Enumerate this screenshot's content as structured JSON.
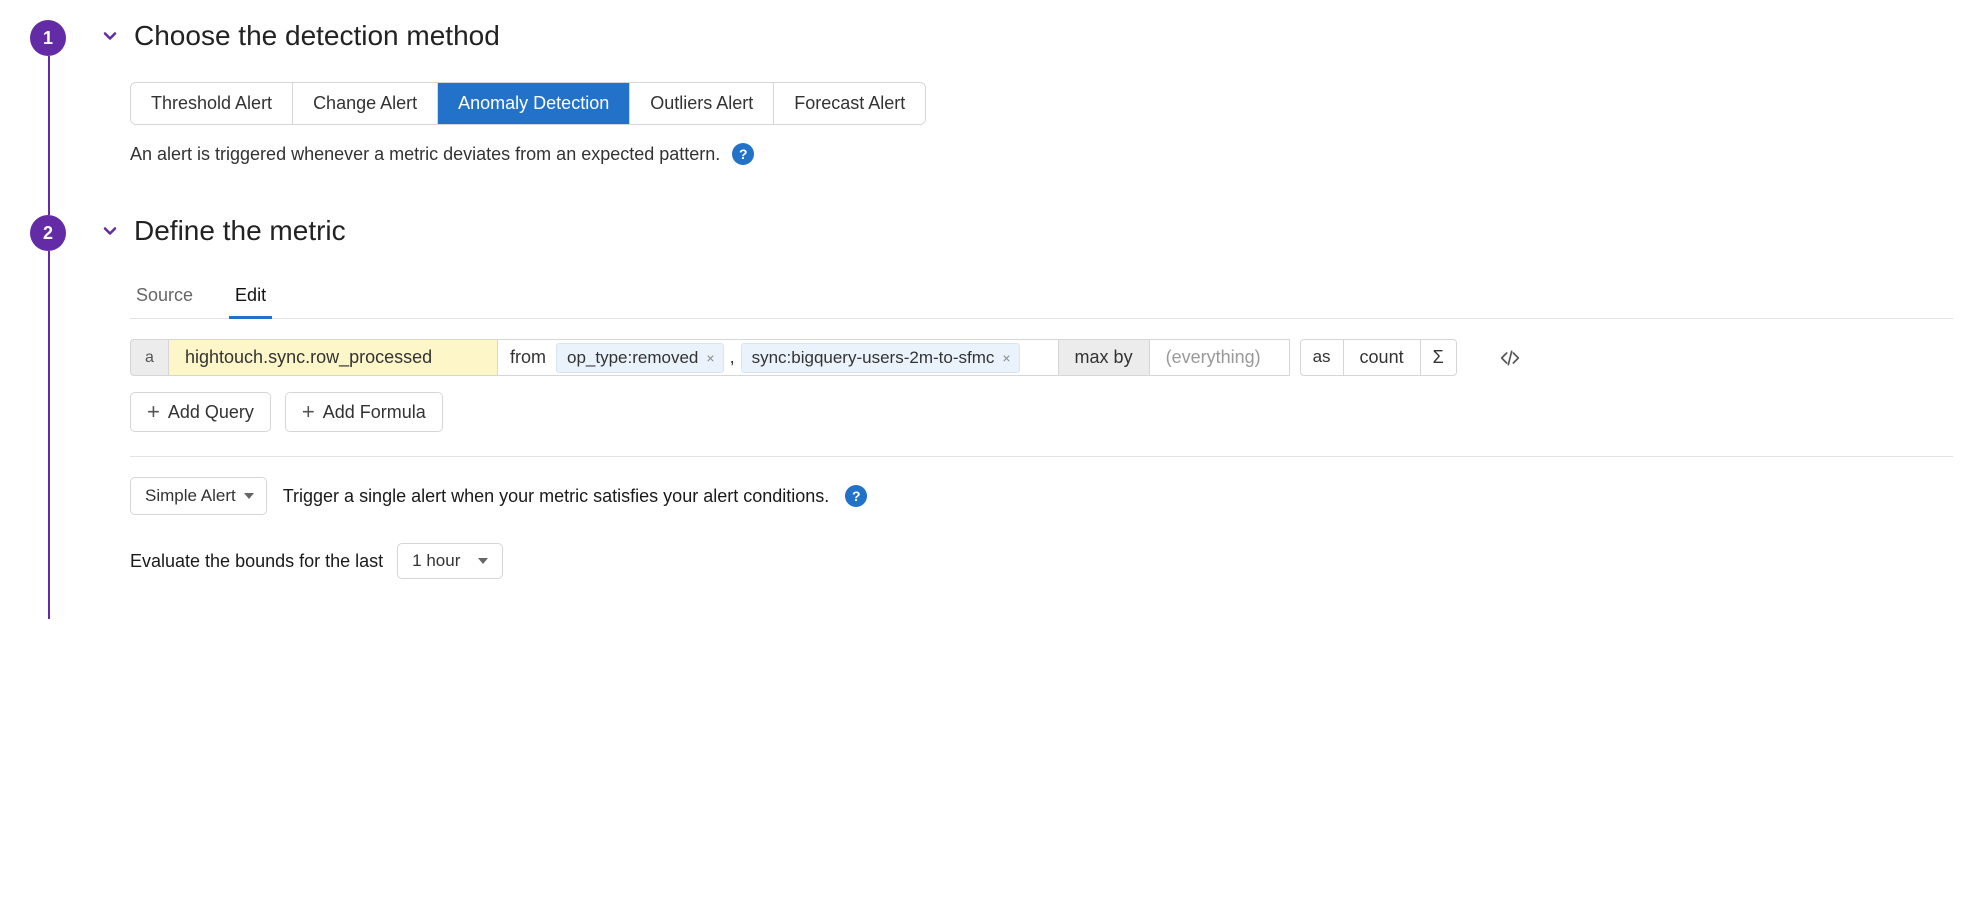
{
  "step1": {
    "number": "1",
    "title": "Choose the detection method",
    "tabs": [
      {
        "label": "Threshold Alert",
        "active": false
      },
      {
        "label": "Change Alert",
        "active": false
      },
      {
        "label": "Anomaly Detection",
        "active": true
      },
      {
        "label": "Outliers Alert",
        "active": false
      },
      {
        "label": "Forecast Alert",
        "active": false
      }
    ],
    "description": "An alert is triggered whenever a metric deviates from an expected pattern."
  },
  "step2": {
    "number": "2",
    "title": "Define the metric",
    "tabs": [
      {
        "label": "Source",
        "active": false
      },
      {
        "label": "Edit",
        "active": true
      }
    ],
    "query": {
      "label": "a",
      "metric": "hightouch.sync.row_processed",
      "from_label": "from",
      "tags": [
        "op_type:removed",
        "sync:bigquery-users-2m-to-sfmc"
      ],
      "maxby_label": "max by",
      "group_placeholder": "(everything)",
      "as_label": "as",
      "as_value": "count",
      "sigma": "Σ"
    },
    "add_query_label": "Add Query",
    "add_formula_label": "Add Formula",
    "alert_mode": {
      "button_label": "Simple Alert",
      "description": "Trigger a single alert when your metric satisfies your alert conditions."
    },
    "evaluate": {
      "label": "Evaluate the bounds for the last",
      "value": "1 hour"
    }
  }
}
